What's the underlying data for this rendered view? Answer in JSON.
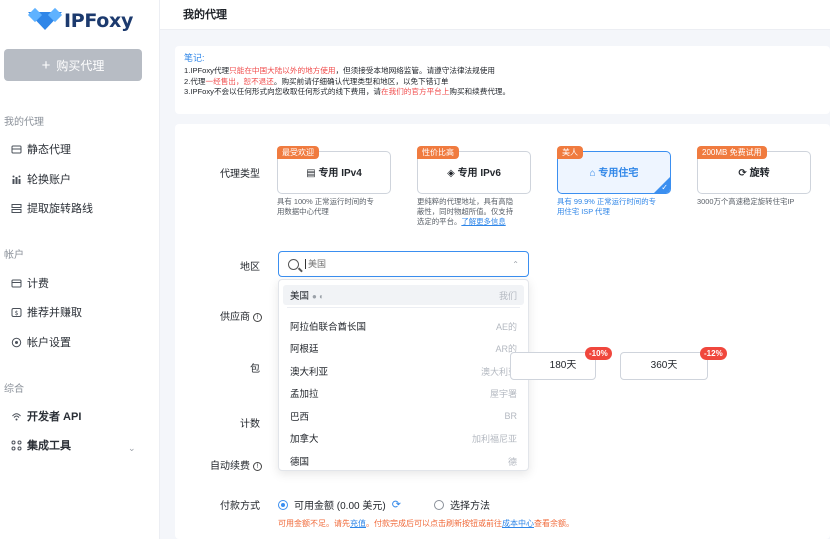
{
  "logo": {
    "text": "IPFoxy"
  },
  "sidebar": {
    "buy_label": "购买代理",
    "sections": [
      {
        "label": "我的代理"
      },
      {
        "label": "帐户"
      },
      {
        "label": "综合"
      }
    ],
    "items": [
      {
        "label": "静态代理",
        "icon": "static-proxy-icon"
      },
      {
        "label": "轮换账户",
        "icon": "rotating-account-icon"
      },
      {
        "label": "提取旋转路线",
        "icon": "extract-route-icon"
      },
      {
        "label": "计费",
        "icon": "billing-icon"
      },
      {
        "label": "推荐并赚取",
        "icon": "referral-icon"
      },
      {
        "label": "帐户设置",
        "icon": "settings-icon"
      },
      {
        "label": "开发者 API",
        "icon": "api-icon"
      },
      {
        "label": "集成工具",
        "icon": "integration-icon"
      }
    ]
  },
  "header": {
    "title": "我的代理"
  },
  "notes": {
    "title": "笔记:",
    "line1_a": "1.IPFoxy代理",
    "line1_red": "只能在中国大陆以外的地方使用",
    "line1_b": "，但须接受本地网络监管。请遵守法律法规使用",
    "line2_a": "2.代理",
    "line2_red": "一经售出，恕不退还",
    "line2_b": "。购买前请仔细确认代理类型和地区，以免下错订单",
    "line3_a": "3.IPFoxy不会以任何形式向您收取任何形式的线下费用，请",
    "line3_red": "在我们的官方平台上",
    "line3_b": "购买和续费代理。"
  },
  "form": {
    "proxy_type_label": "代理类型",
    "region_label": "地区",
    "supplier_label": "供应商",
    "package_label": "包",
    "billing_label": "计数",
    "auto_renew_label": "自动续费",
    "payment_label": "付款方式"
  },
  "proxy_types": [
    {
      "tag": "最受欢迎",
      "name": "专用 IPv4",
      "icon": "server-icon",
      "desc1": "具有 100% 正常运行时间的专",
      "desc2": "用数据中心代理",
      "desc3": ""
    },
    {
      "tag": "性价比高",
      "name": "专用 IPv6",
      "icon": "layers-icon",
      "desc1": "更纯粹的代理地址，具有高隐",
      "desc2": "蔽性，同时物超所值。仅支持",
      "desc3": "选定的平台。",
      "link": "了解更多信息"
    },
    {
      "tag": "美人",
      "name": "专用住宅",
      "icon": "home-icon",
      "desc1": "具有 99.9% 正常运行时间的专",
      "desc2": "用住宅 ISP 代理",
      "desc3": ""
    },
    {
      "tag": "200MB 免费试用",
      "name": "旋转",
      "icon": "rotate-icon",
      "desc1": "3000万个高速稳定旋转住宅IP",
      "desc2": "",
      "desc3": ""
    }
  ],
  "region": {
    "placeholder": "美国",
    "options": [
      {
        "name": "美国",
        "right": "我们"
      },
      {
        "name": "阿拉伯联合酋长国",
        "right": "AE的"
      },
      {
        "name": "阿根廷",
        "right": "AR的"
      },
      {
        "name": "澳大利亚",
        "right": "澳大利亚"
      },
      {
        "name": "孟加拉",
        "right": "屋宇署"
      },
      {
        "name": "巴西",
        "right": "BR"
      },
      {
        "name": "加拿大",
        "right": "加利福尼亚"
      },
      {
        "name": "德国",
        "right": "德"
      }
    ]
  },
  "durations": [
    {
      "label": "180天",
      "discount": "-10%"
    },
    {
      "label": "360天",
      "discount": "-12%"
    }
  ],
  "payment": {
    "option1": "可用金额  (0.00 美元)",
    "option2": "选择方法",
    "warn_a": "可用金额不足。请先",
    "warn_link1": "充值",
    "warn_b": "。付款完成后可以点击刷新按钮或前往",
    "warn_link2": "成本中心",
    "warn_c": "查看余额。"
  },
  "colors": {
    "accent": "#2f86e8",
    "tag": "#f07b3f",
    "warn": "#f06a3a",
    "badge": "#f0473d"
  }
}
